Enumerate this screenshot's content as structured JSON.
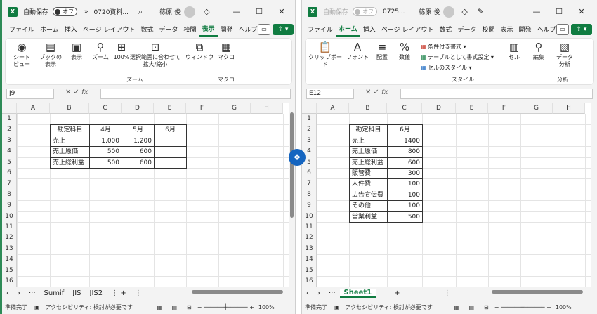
{
  "left": {
    "autosave_label": "自動保存",
    "autosave_state": "オフ",
    "file_name": "0720資料...",
    "user": "篠原 俊",
    "menu": [
      "ファイル",
      "ホーム",
      "挿入",
      "ページ レイアウト",
      "数式",
      "データ",
      "校閲",
      "表示",
      "開発",
      "ヘルプ"
    ],
    "active_menu": "表示",
    "ribbon": {
      "sheet_view": "シート\nビュー",
      "book_view": "ブックの\n表示",
      "show": "表示",
      "zoom": "ズーム",
      "zoom100": "100%",
      "zoom_sel": "選択範囲に合わせて\n拡大/縮小",
      "window": "ウィンドウ",
      "macro": "マクロ",
      "group_zoom": "ズーム",
      "group_macro": "マクロ"
    },
    "name_box": "J9",
    "columns": [
      "A",
      "B",
      "C",
      "D",
      "E",
      "F",
      "G",
      "H"
    ],
    "rows": [
      "1",
      "2",
      "3",
      "4",
      "5",
      "6",
      "7",
      "8",
      "9",
      "10",
      "11",
      "12",
      "13",
      "14",
      "15",
      "16"
    ],
    "table": [
      [
        "勘定科目",
        "4月",
        "5月",
        "6月"
      ],
      [
        "売上",
        "1,000",
        "1,200",
        ""
      ],
      [
        "売上原価",
        "500",
        "600",
        ""
      ],
      [
        "売上総利益",
        "500",
        "600",
        ""
      ]
    ],
    "tabs": [
      "Sumif",
      "JIS",
      "JIS2"
    ],
    "status_ready": "準備完了",
    "accessibility": "アクセシビリティ: 検討が必要です",
    "zoom_level": "100%"
  },
  "right": {
    "autosave_state": "オフ",
    "file_name": "0725...",
    "user": "篠原 俊",
    "menu": [
      "ファイル",
      "ホーム",
      "挿入",
      "ページ レイアウト",
      "数式",
      "データ",
      "校閲",
      "表示",
      "開発",
      "ヘルプ"
    ],
    "active_menu": "ホーム",
    "ribbon": {
      "clipboard": "クリップボード",
      "font": "フォント",
      "align": "配置",
      "number": "数値",
      "cond_format": "条件付き書式",
      "table_format": "テーブルとして書式設定",
      "cell_style": "セルのスタイル",
      "cells": "セル",
      "edit": "編集",
      "data_analysis": "データ\n分析",
      "group_style": "スタイル",
      "group_analysis": "分析"
    },
    "name_box": "E12",
    "columns": [
      "A",
      "B",
      "C",
      "D",
      "E",
      "F",
      "G",
      "H"
    ],
    "rows": [
      "1",
      "2",
      "3",
      "4",
      "5",
      "6",
      "7",
      "8",
      "9",
      "10",
      "11",
      "12",
      "13",
      "14",
      "15",
      "16"
    ],
    "table": [
      [
        "勘定科目",
        "6月"
      ],
      [
        "売上",
        "1400"
      ],
      [
        "売上原価",
        "800"
      ],
      [
        "売上総利益",
        "600"
      ],
      [
        "販管費",
        "300"
      ],
      [
        "人件費",
        "100"
      ],
      [
        "広告宣伝費",
        "100"
      ],
      [
        "その他",
        "100"
      ],
      [
        "営業利益",
        "500"
      ]
    ],
    "tabs": [
      "Sheet1"
    ],
    "status_ready": "準備完了",
    "accessibility": "アクセシビリティ: 検討が必要です",
    "zoom_level": "100%"
  },
  "colors": {
    "accent": "#107c41",
    "chrome": "#f3f3f3",
    "dropbox": "#1565c0"
  },
  "icons": {
    "dropbox": "dropbox-icon"
  }
}
